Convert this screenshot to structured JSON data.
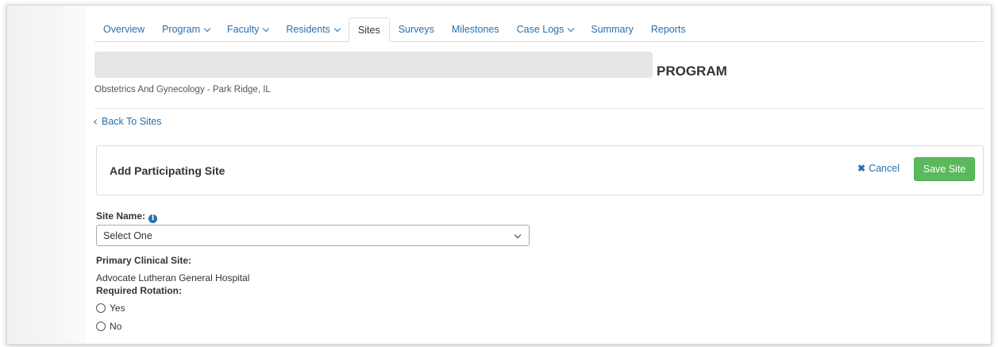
{
  "nav": {
    "tabs": [
      {
        "label": "Overview",
        "dropdown": false
      },
      {
        "label": "Program",
        "dropdown": true
      },
      {
        "label": "Faculty",
        "dropdown": true
      },
      {
        "label": "Residents",
        "dropdown": true
      },
      {
        "label": "Sites",
        "dropdown": false,
        "active": true
      },
      {
        "label": "Surveys",
        "dropdown": false
      },
      {
        "label": "Milestones",
        "dropdown": false
      },
      {
        "label": "Case Logs",
        "dropdown": true
      },
      {
        "label": "Summary",
        "dropdown": false
      },
      {
        "label": "Reports",
        "dropdown": false
      }
    ]
  },
  "header": {
    "program_label": "PROGRAM",
    "subtitle": "Obstetrics And Gynecology - Park Ridge, IL"
  },
  "back_link": "Back To Sites",
  "panel": {
    "title": "Add Participating Site",
    "cancel_label": "Cancel",
    "save_label": "Save Site"
  },
  "form": {
    "site_name_label": "Site Name:",
    "site_name_value": "Select One",
    "primary_site_label": "Primary Clinical Site:",
    "primary_site_value": "Advocate Lutheran General Hospital",
    "required_rotation_label": "Required Rotation:",
    "options": [
      "Yes",
      "No"
    ]
  },
  "colors": {
    "link": "#2a6fb0",
    "save_button": "#5cb85c"
  }
}
